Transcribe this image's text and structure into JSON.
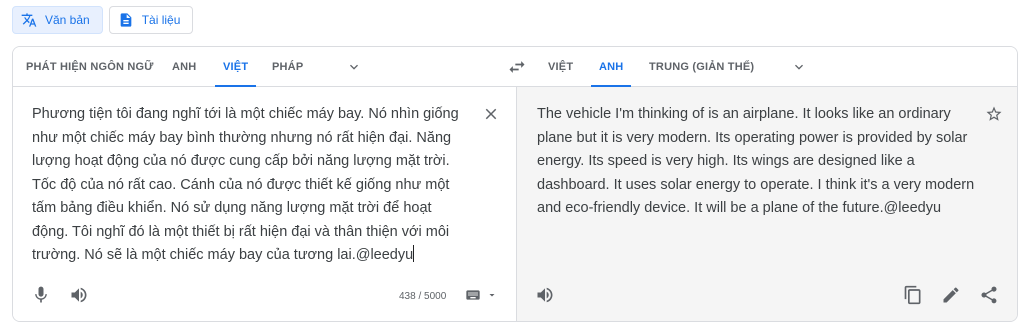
{
  "modes": [
    {
      "label": "Văn bản",
      "icon": "translate-icon",
      "active": true
    },
    {
      "label": "Tài liệu",
      "icon": "document-icon",
      "active": false
    }
  ],
  "source_langs": [
    {
      "label": "PHÁT HIỆN NGÔN NGỮ",
      "active": false
    },
    {
      "label": "ANH",
      "active": false
    },
    {
      "label": "VIỆT",
      "active": true
    },
    {
      "label": "PHÁP",
      "active": false
    }
  ],
  "target_langs": [
    {
      "label": "VIỆT",
      "active": false
    },
    {
      "label": "ANH",
      "active": true
    },
    {
      "label": "TRUNG (GIẢN THỂ)",
      "active": false
    }
  ],
  "source": {
    "text": "Phương tiện tôi đang nghĩ tới là một chiếc máy bay. Nó nhìn giống như một chiếc máy bay bình thường nhưng nó rất hiện đại. Năng lượng hoạt động của nó được cung cấp bởi năng lượng mặt trời. Tốc độ của nó rất cao. Cánh của nó được thiết kế giống như một tấm bảng điều khiển. Nó sử dụng năng lượng mặt trời để hoạt động. Tôi nghĩ đó là một thiết bị rất hiện đại và thân thiện với môi trường. Nó sẽ là một chiếc máy bay của tương lai.@leedyu",
    "char_count": "438 / 5000"
  },
  "translation": {
    "text": "The vehicle I'm thinking of is an airplane. It looks like an ordinary plane but it is very modern. Its operating power is provided by solar energy. Its speed is very high. Its wings are designed like a dashboard. It uses solar energy to operate. I think it's a very modern and eco-friendly device. It will be a plane of the future.@leedyu"
  },
  "colors": {
    "accent": "#1a73e8",
    "icon": "#5f6368",
    "result_bg": "#f5f5f5",
    "border": "#dadce0"
  }
}
